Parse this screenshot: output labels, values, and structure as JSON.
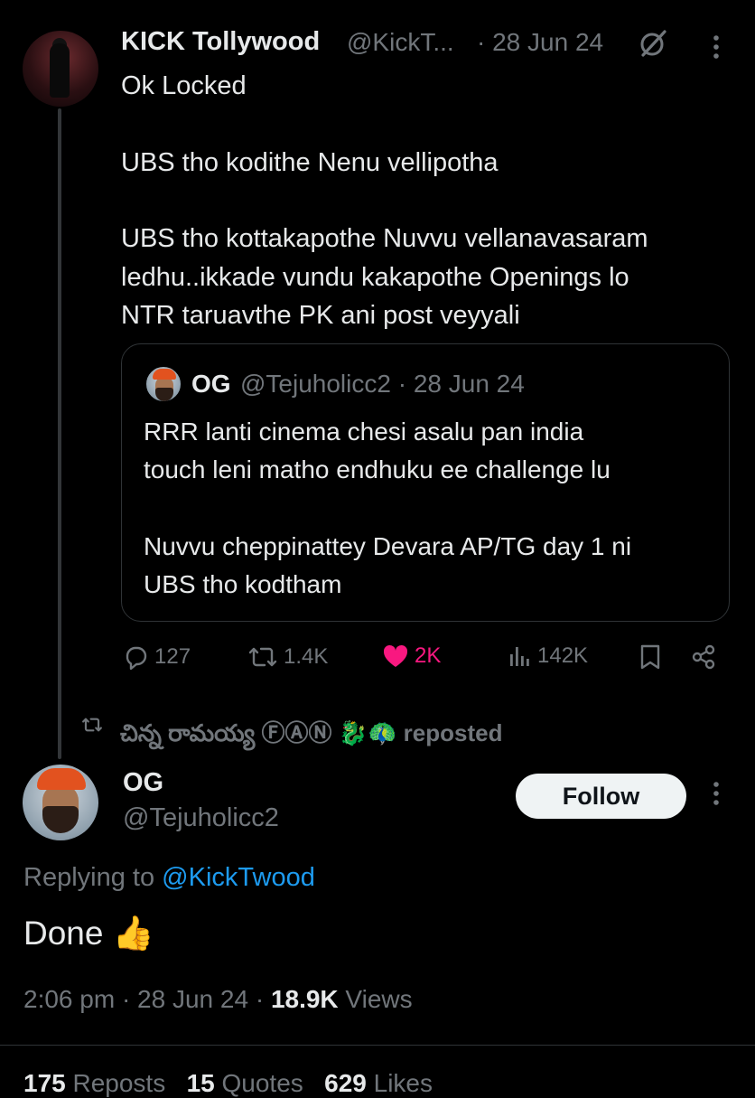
{
  "tweet": {
    "author_name": "KICK Tollywood",
    "author_handle": "@KickT...",
    "date": "· 28 Jun 24",
    "body": [
      "Ok Locked",
      "",
      "UBS tho kodithe Nenu vellipotha",
      "",
      "UBS tho kottakapothe Nuvvu vellanavasaram",
      "ledhu..ikkade vundu kakapothe Openings lo",
      "NTR taruavthe PK ani post veyyali"
    ],
    "icons": {
      "grok": "grok-icon",
      "more": "more-options-icon"
    }
  },
  "quote": {
    "author_name": "OG",
    "author_handle": "@Tejuholicc2 · 28 Jun 24",
    "body": [
      "RRR lanti cinema chesi asalu pan india",
      "touch leni matho endhuku ee challenge lu",
      "",
      "Nuvvu cheppinattey Devara AP/TG day 1 ni",
      "UBS tho kodtham"
    ]
  },
  "actions": {
    "replies": "127",
    "reposts": "1.4K",
    "likes": "2K",
    "views": "142K",
    "like_color": "#f91880"
  },
  "repost_banner": {
    "text": "చిన్న రామయ్య ⒻⒶⓃ 🐉🦚 reposted"
  },
  "reply": {
    "author_name": "OG",
    "author_handle": "@Tejuholicc2",
    "follow_label": "Follow",
    "replying_prefix": "Replying to ",
    "replying_to": "@KickTwood",
    "body": "Done 👍",
    "time": "2:06 pm · 28 Jun 24 · ",
    "views_count": "18.9K",
    "views_label": " Views"
  },
  "stats": {
    "reposts_count": "175",
    "reposts_label": " Reposts",
    "quotes_count": "15",
    "quotes_label": " Quotes",
    "likes_count": "629",
    "likes_label": " Likes"
  },
  "colors": {
    "background": "#000000",
    "text": "#e7e9ea",
    "muted": "#71767b",
    "link": "#1d9bf0",
    "like": "#f91880"
  }
}
